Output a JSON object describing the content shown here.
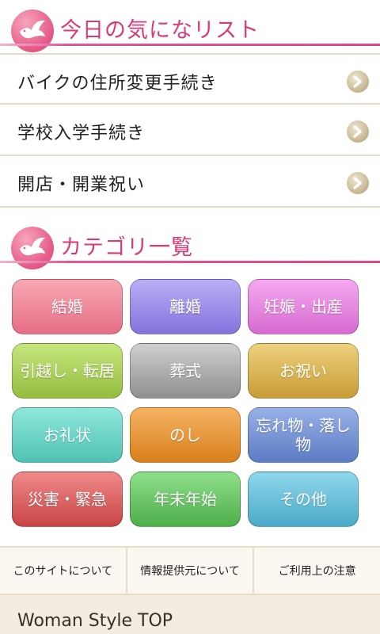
{
  "sections": {
    "favorites_title": "今日の気になリスト",
    "categories_title": "カテゴリ一覧"
  },
  "favorites": [
    {
      "label": "バイクの住所変更手続き"
    },
    {
      "label": "学校入学手続き"
    },
    {
      "label": "開店・開業祝い"
    }
  ],
  "categories": [
    {
      "label": "結婚",
      "color_top": "#f8a8b4",
      "color_bottom": "#e66e86"
    },
    {
      "label": "離婚",
      "color_top": "#b9aef5",
      "color_bottom": "#8472dc"
    },
    {
      "label": "妊娠・出産",
      "color_top": "#f6a8f0",
      "color_bottom": "#d66bd0"
    },
    {
      "label": "引越し・転居",
      "color_top": "#c6e67c",
      "color_bottom": "#94bd3f"
    },
    {
      "label": "葬式",
      "color_top": "#cfcfcf",
      "color_bottom": "#8f8f8f"
    },
    {
      "label": "お祝い",
      "color_top": "#ecd17d",
      "color_bottom": "#c99c36"
    },
    {
      "label": "お礼状",
      "color_top": "#8fe7db",
      "color_bottom": "#4fc2b3"
    },
    {
      "label": "のし",
      "color_top": "#f4b362",
      "color_bottom": "#d97f1c"
    },
    {
      "label": "忘れ物・落し物",
      "color_top": "#97b0e6",
      "color_bottom": "#5c7cc4"
    },
    {
      "label": "災害・緊急",
      "color_top": "#f08a8a",
      "color_bottom": "#c94444"
    },
    {
      "label": "年末年始",
      "color_top": "#8ee08a",
      "color_bottom": "#4fae4a"
    },
    {
      "label": "その他",
      "color_top": "#8fd8ec",
      "color_bottom": "#4aa9c8"
    }
  ],
  "footer": {
    "links": [
      "このサイトについて",
      "情報提供元について",
      "ご利用上の注意"
    ],
    "bottom_text": "Woman Style TOP"
  },
  "colors": {
    "accent": "#d83a78",
    "divider": "#e6ddc8"
  },
  "icons": {
    "logo": "dove-icon",
    "row_arrow": "chevron-right-icon"
  }
}
